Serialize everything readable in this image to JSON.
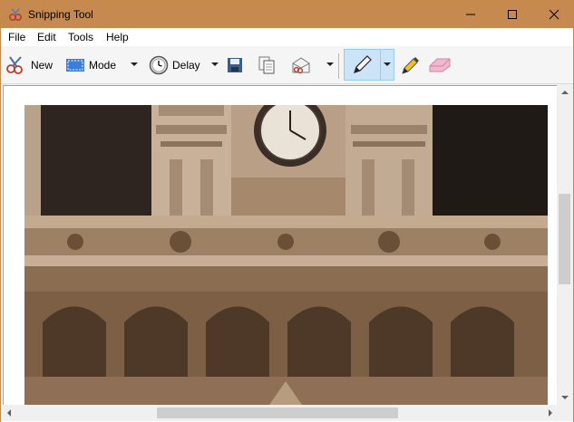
{
  "window": {
    "title": "Snipping Tool",
    "title_bar_color": "#c68a50"
  },
  "menu": {
    "items": [
      {
        "label": "File"
      },
      {
        "label": "Edit"
      },
      {
        "label": "Tools"
      },
      {
        "label": "Help"
      }
    ]
  },
  "toolbar": {
    "new_label": "New",
    "mode_label": "Mode",
    "delay_label": "Delay",
    "icons": [
      "new-snip-icon",
      "mode-icon",
      "delay-clock-icon",
      "save-icon",
      "copy-icon",
      "send-snip-icon",
      "pen-icon",
      "highlighter-icon",
      "eraser-icon"
    ],
    "active_tool": "pen",
    "active_color": "#cce4f7"
  },
  "canvas": {
    "image_description_icon": "snip-image"
  }
}
